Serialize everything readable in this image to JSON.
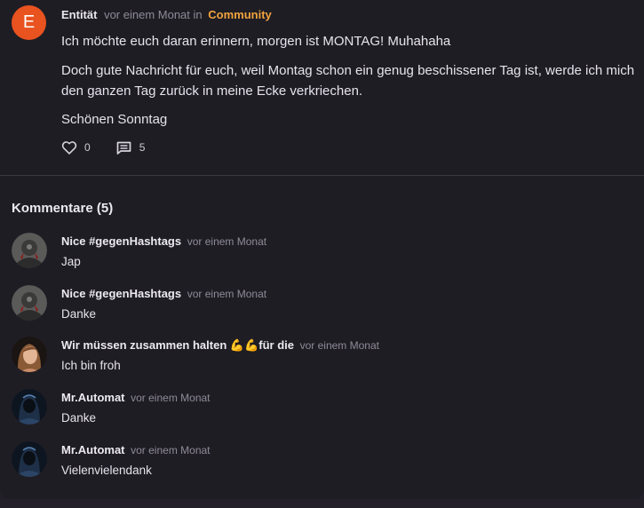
{
  "post": {
    "avatar_letter": "E",
    "author": "Entität",
    "time": "vor einem Monat",
    "in_label": "in",
    "category": "Community",
    "paragraphs": [
      "Ich möchte euch daran erinnern, morgen ist MONTAG! Muhahaha",
      "Doch gute Nachricht für euch, weil Montag schon ein genug beschissener Tag ist, werde ich mich den ganzen Tag zurück in meine Ecke verkriechen.",
      "Schönen Sonntag"
    ],
    "likes": "0",
    "comments_count": "5"
  },
  "comments_section": {
    "title": "Kommentare (5)",
    "items": [
      {
        "author": "Nice #gegenHashtags",
        "time": "vor einem Monat",
        "text": "Jap"
      },
      {
        "author": "Nice #gegenHashtags",
        "time": "vor einem Monat",
        "text": "Danke"
      },
      {
        "author": "Wir müssen zusammen halten 💪💪für die",
        "time": "vor einem Monat",
        "text": "Ich bin froh"
      },
      {
        "author": "Mr.Automat",
        "time": "vor einem Monat",
        "text": "Danke"
      },
      {
        "author": "Mr.Automat",
        "time": "vor einem Monat",
        "text": "Vielenvielendank"
      }
    ]
  },
  "colors": {
    "background": "#1f1d24",
    "accent_category": "#f1a33e",
    "avatar_letter_bg": "#e9531f",
    "muted_text": "#8e8a97"
  },
  "icons": {
    "like": "heart-outline-icon",
    "comments": "comment-icon"
  }
}
